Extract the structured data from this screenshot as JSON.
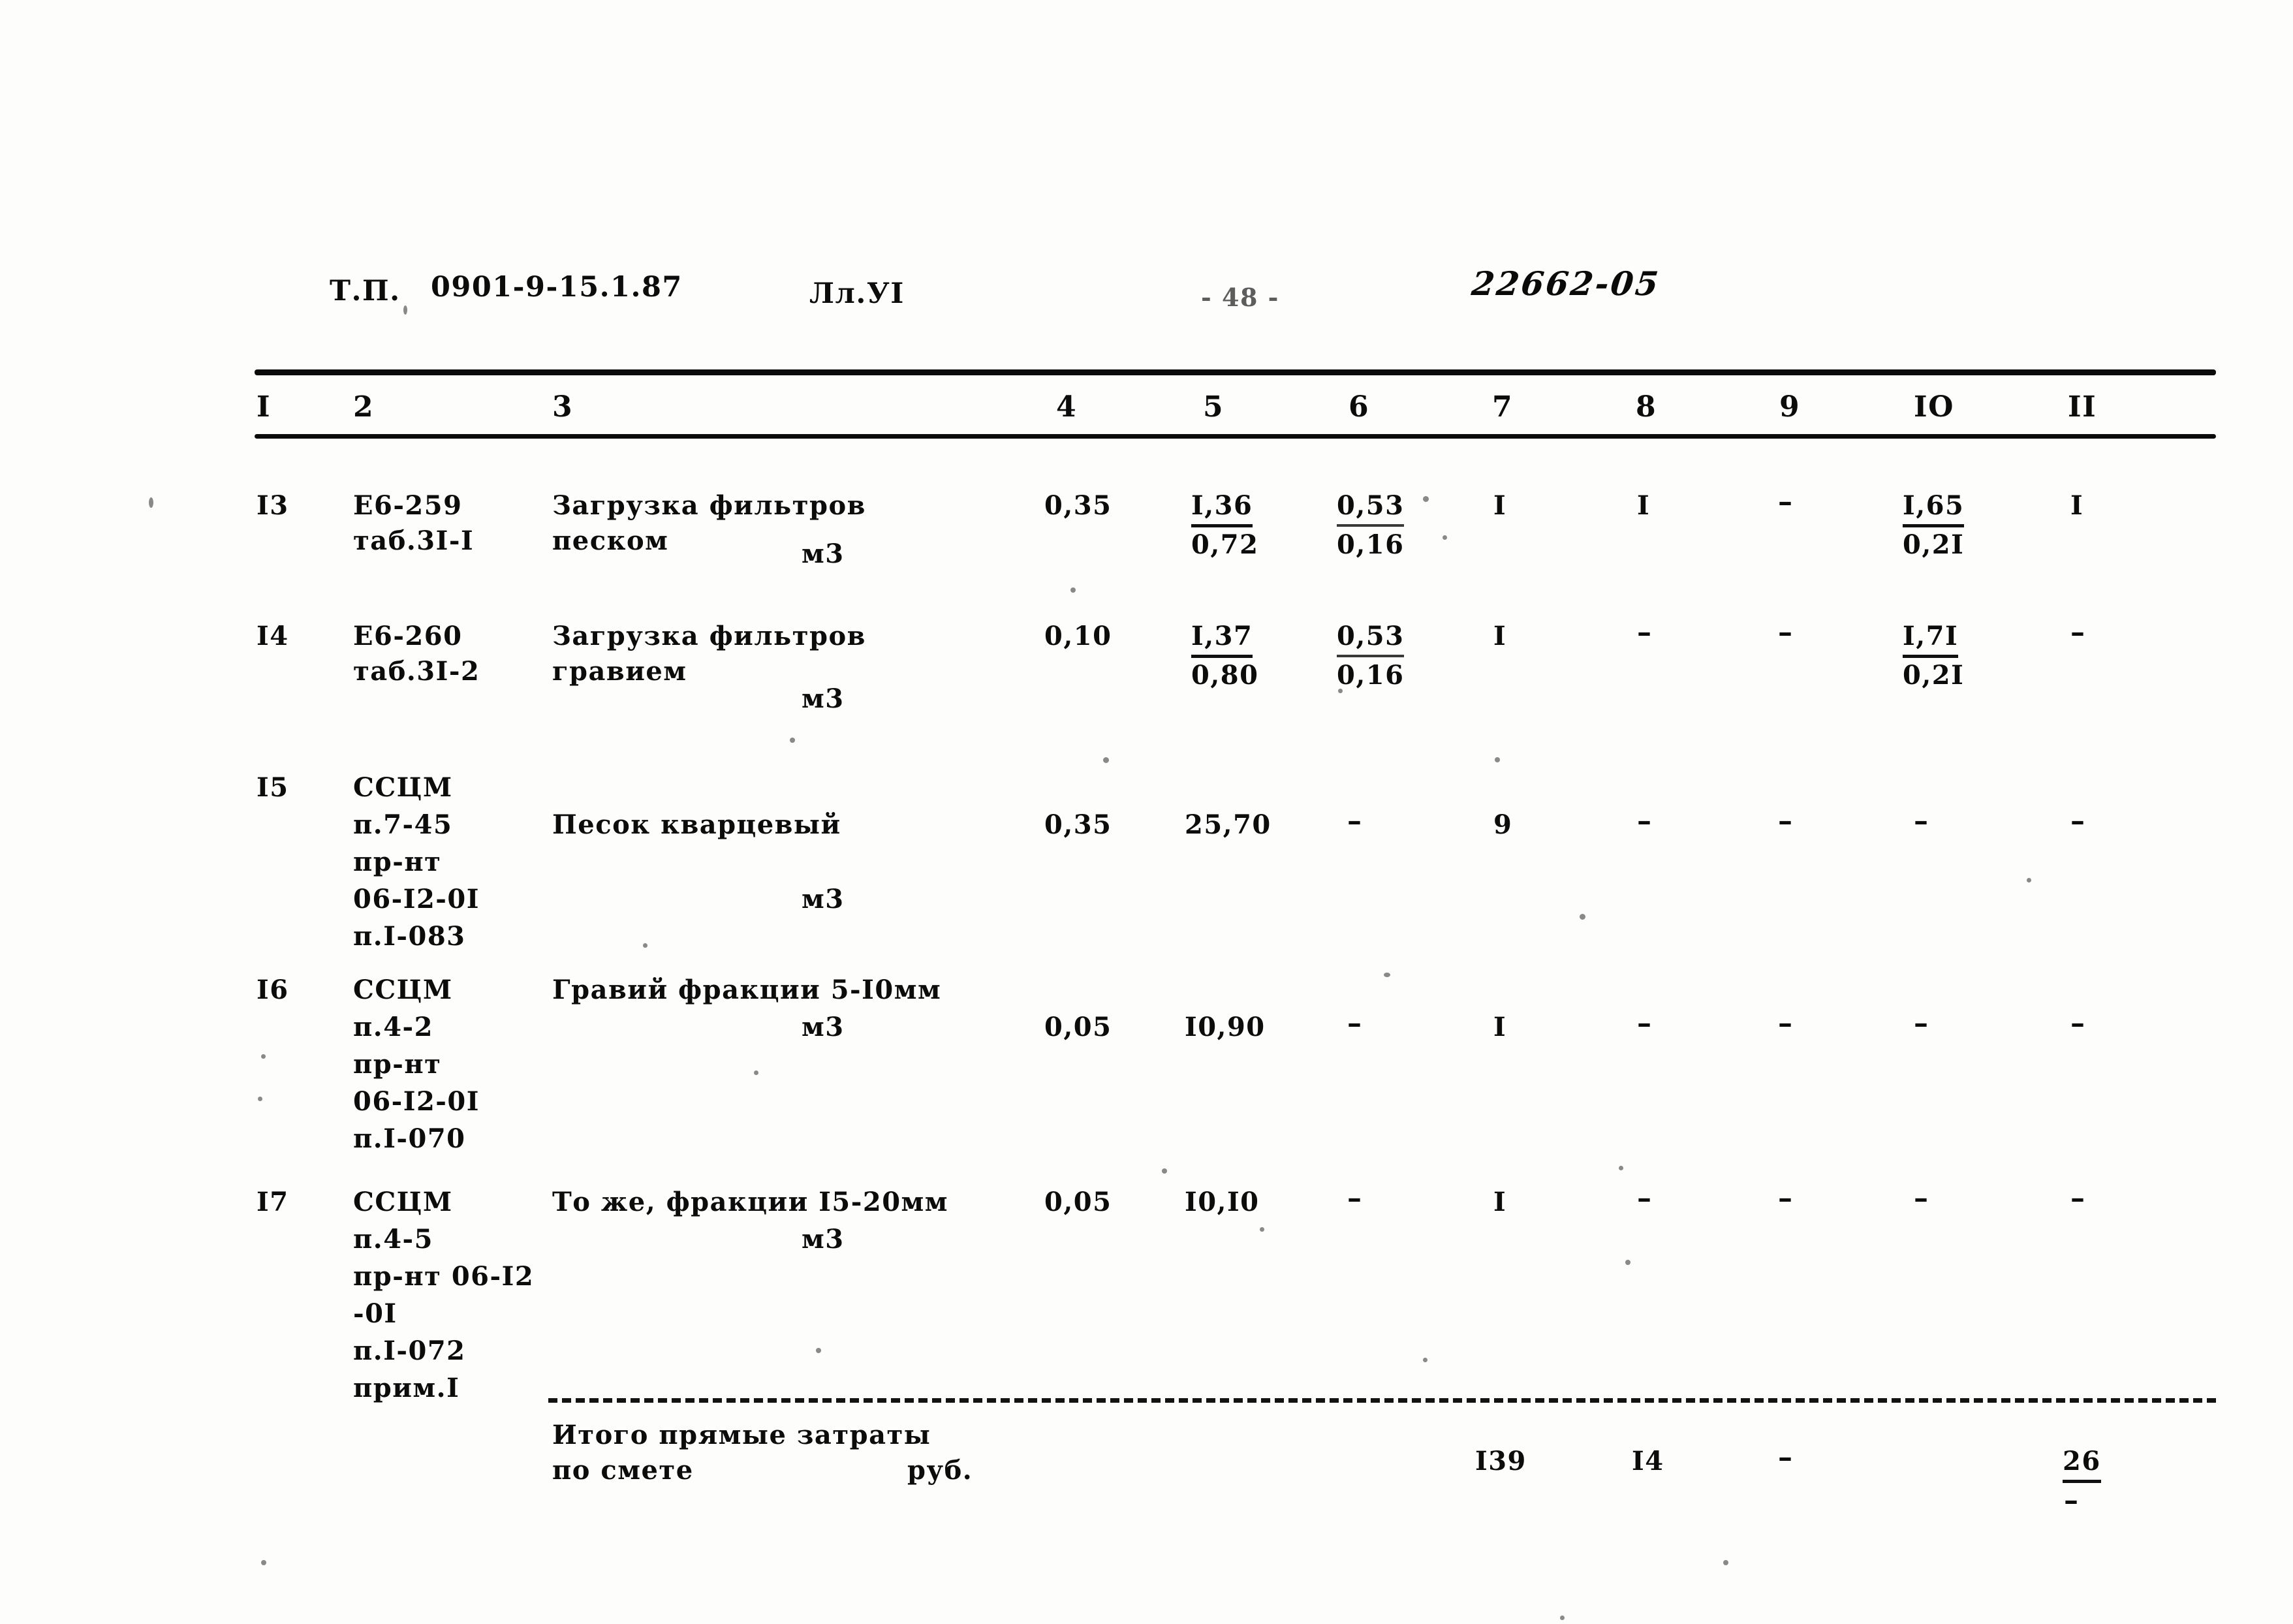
{
  "header": {
    "doc_type": "Т.П.",
    "doc_code": "0901-9-15.1.87",
    "sheet": "Лл.УI",
    "page_marker": "- 48 -",
    "handwritten_number": "22662-05"
  },
  "table": {
    "column_headers": [
      "I",
      "2",
      "3",
      "4",
      "5",
      "6",
      "7",
      "8",
      "9",
      "IO",
      "II"
    ],
    "rows": [
      {
        "num": "I3",
        "code_lines": [
          "Е6-259",
          "таб.3I-I"
        ],
        "desc_lines": [
          "Загрузка фильтров",
          "песком"
        ],
        "unit": "м3",
        "c4": "0,35",
        "c5_top": "I,36",
        "c5_bot": "0,72",
        "c6_top": "0,53",
        "c6_bot": "0,16",
        "c7": "I",
        "c8": "I",
        "c9": "–",
        "c10_top": "I,65",
        "c10_bot": "0,2I",
        "c11": "I"
      },
      {
        "num": "I4",
        "code_lines": [
          "Е6-260",
          "таб.3I-2"
        ],
        "desc_lines": [
          "Загрузка фильтров",
          "гравием"
        ],
        "unit": "м3",
        "c4": "0,10",
        "c5_top": "I,37",
        "c5_bot": "0,80",
        "c6_top": "0,53",
        "c6_bot": "0,16",
        "c7": "I",
        "c8": "–",
        "c9": "–",
        "c10_top": "I,7I",
        "c10_bot": "0,2I",
        "c11": "–"
      },
      {
        "num": "I5",
        "code_lines": [
          "ССЦМ",
          "п.7-45",
          "пр-нт",
          "06-I2-0I",
          "п.I-083"
        ],
        "desc_lines": [
          "Песок кварцевый"
        ],
        "unit": "м3",
        "c4": "0,35",
        "c5_top": "25,70",
        "c5_bot": "",
        "c6_top": "–",
        "c6_bot": "",
        "c7": "9",
        "c8": "–",
        "c9": "–",
        "c10_top": "–",
        "c10_bot": "",
        "c11": "–"
      },
      {
        "num": "I6",
        "code_lines": [
          "ССЦМ",
          "п.4-2",
          "пр-нт",
          "06-I2-0I",
          "п.I-070"
        ],
        "desc_lines": [
          "Гравий фракции 5-I0мм"
        ],
        "unit": "м3",
        "c4": "0,05",
        "c5_top": "I0,90",
        "c5_bot": "",
        "c6_top": "–",
        "c6_bot": "",
        "c7": "I",
        "c8": "–",
        "c9": "–",
        "c10_top": "–",
        "c10_bot": "",
        "c11": "–"
      },
      {
        "num": "I7",
        "code_lines": [
          "ССЦМ",
          "п.4-5",
          "пр-нт 06-I2",
          "-0I",
          "п.I-072",
          "прим.I"
        ],
        "desc_lines": [
          "То же, фракции I5-20мм"
        ],
        "unit": "м3",
        "c4": "0,05",
        "c5_top": "I0,I0",
        "c5_bot": "",
        "c6_top": "–",
        "c6_bot": "",
        "c7": "I",
        "c8": "–",
        "c9": "–",
        "c10_top": "–",
        "c10_bot": "",
        "c11": "–"
      }
    ],
    "totals": {
      "label_line1": "Итого прямые затраты",
      "label_line2": "по смете",
      "unit": "руб.",
      "c7": "I39",
      "c8": "I4",
      "c9": "–",
      "c10": "",
      "c11": "26",
      "c11_sub": "–"
    }
  }
}
